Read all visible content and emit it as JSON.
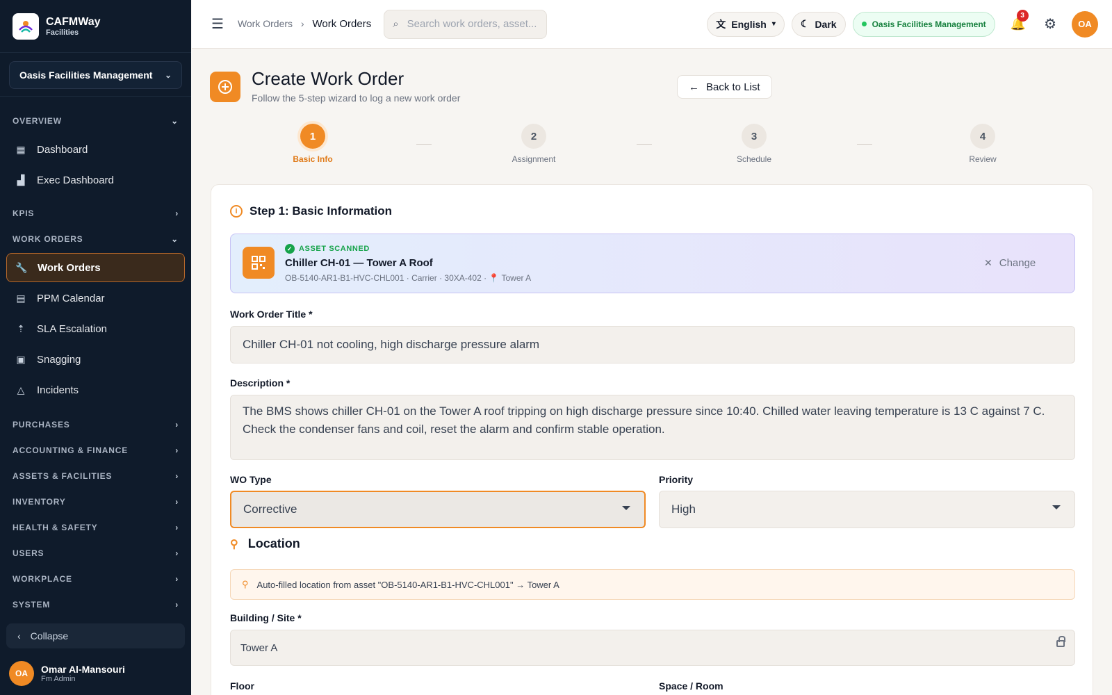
{
  "brand": {
    "name": "CAFMWay",
    "sub": "Facilities"
  },
  "org_selector": "Oasis Facilities Management",
  "sidebar": {
    "overview": "OVERVIEW",
    "overview_items": [
      "Dashboard",
      "Exec Dashboard"
    ],
    "kpis": "KPIS",
    "work_orders": "WORK ORDERS",
    "work_order_items": [
      "Work Orders",
      "PPM Calendar",
      "SLA Escalation",
      "Snagging",
      "Incidents"
    ],
    "collapsed_sections": [
      "PURCHASES",
      "ACCOUNTING & FINANCE",
      "ASSETS & FACILITIES",
      "INVENTORY",
      "HEALTH & SAFETY",
      "USERS",
      "WORKPLACE",
      "SYSTEM"
    ],
    "collapse": "Collapse"
  },
  "user": {
    "initials": "OA",
    "name": "Omar Al-Mansouri",
    "role": "Fm Admin"
  },
  "topbar": {
    "breadcrumb": [
      "Work Orders",
      "Work Orders"
    ],
    "search_placeholder": "Search work orders, asset...",
    "language": "English",
    "theme": "Dark",
    "org_badge": "Oasis Facilities Management",
    "notifications": "3",
    "avatar": "OA"
  },
  "page": {
    "title": "Create Work Order",
    "subtitle": "Follow the 5-step wizard to log a new work order",
    "back": "Back to List"
  },
  "steps": [
    {
      "num": "1",
      "label": "Basic Info"
    },
    {
      "num": "2",
      "label": "Assignment"
    },
    {
      "num": "3",
      "label": "Schedule"
    },
    {
      "num": "4",
      "label": "Review"
    }
  ],
  "form": {
    "section_title": "Step 1: Basic Information",
    "asset": {
      "tag": "ASSET SCANNED",
      "name": "Chiller CH-01 — Tower A Roof",
      "meta": "OB-5140-AR1-B1-HVC-CHL001 · Carrier · 30XA-402 · 📍 Tower A",
      "change": "Change"
    },
    "title_label": "Work Order Title *",
    "title_value": "Chiller CH-01 not cooling, high discharge pressure alarm",
    "description_label": "Description *",
    "description_value": "The BMS shows chiller CH-01 on the Tower A roof tripping on high discharge pressure since 10:40. Chilled water leaving temperature is 13 C against 7 C. Check the condenser fans and coil, reset the alarm and confirm stable operation.",
    "wo_type_label": "WO Type",
    "wo_type_value": "Corrective",
    "priority_label": "Priority",
    "priority_value": "High",
    "location_title": "Location",
    "autofill_note": "Auto-filled location from asset \"OB-5140-AR1-B1-HVC-CHL001\" → Tower A",
    "building_label": "Building / Site *",
    "building_value": "Tower A",
    "floor_label": "Floor",
    "space_label": "Space / Room"
  },
  "colors": {
    "accent": "#f08a24",
    "sidebar_bg": "#0f1b2b",
    "success": "#16a34a",
    "notification": "#dc2626"
  }
}
